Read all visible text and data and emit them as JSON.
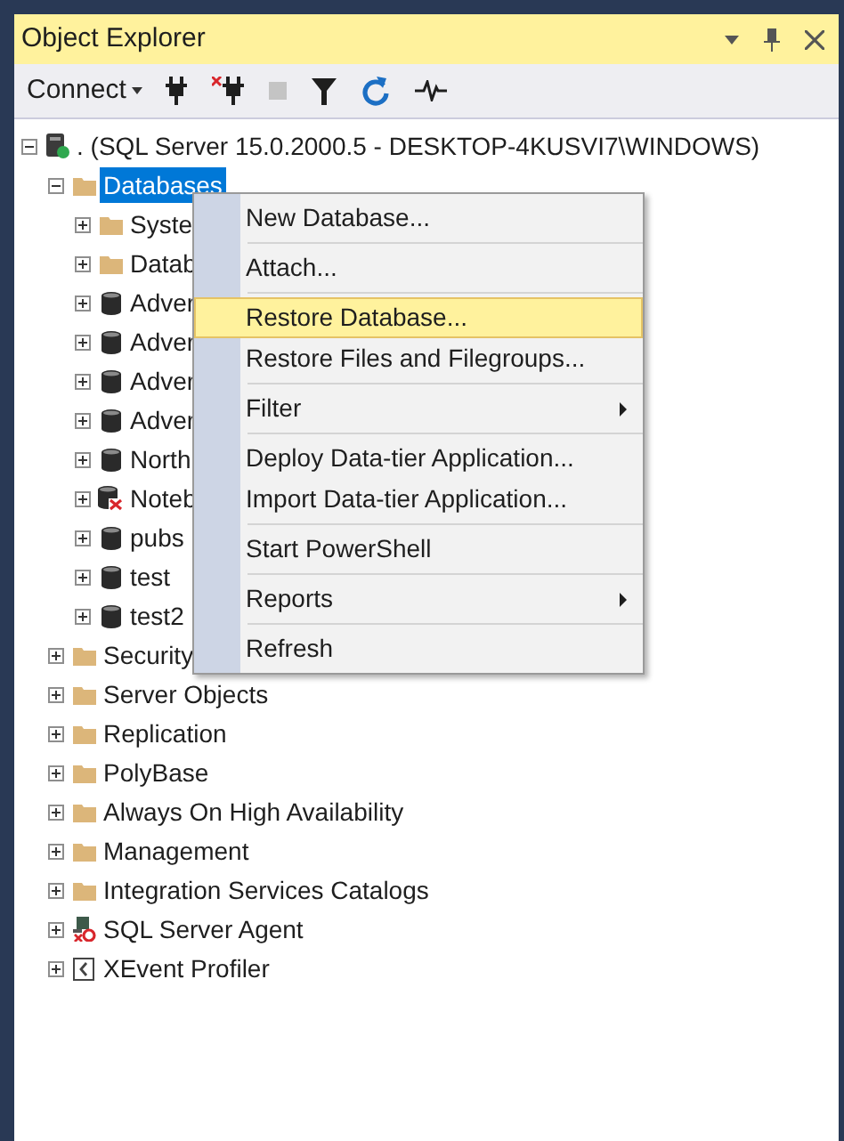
{
  "panel": {
    "title": "Object Explorer"
  },
  "toolbar": {
    "connect_label": "Connect",
    "buttons": [
      {
        "kind": "connect",
        "disabled": false
      },
      {
        "kind": "disconnect",
        "disabled": false
      },
      {
        "kind": "stop",
        "disabled": true
      },
      {
        "kind": "filter",
        "disabled": false
      },
      {
        "kind": "refresh",
        "disabled": false
      },
      {
        "kind": "activity",
        "disabled": false
      }
    ]
  },
  "tree": [
    {
      "label": ". (SQL Server 15.0.2000.5 - DESKTOP-4KUSVI7\\WINDOWS)",
      "kind": "server",
      "expanded": true,
      "selected": false,
      "children": [
        {
          "label": "Databases",
          "kind": "folder",
          "expanded": true,
          "selected": true,
          "children": [
            {
              "label": "Syste",
              "kind": "folder",
              "expanded": false,
              "selected": false
            },
            {
              "label": "Datab",
              "kind": "folder",
              "expanded": false,
              "selected": false
            },
            {
              "label": "Adver",
              "kind": "database",
              "expanded": false,
              "selected": false
            },
            {
              "label": "Adver",
              "kind": "database",
              "expanded": false,
              "selected": false
            },
            {
              "label": "Adver",
              "kind": "database",
              "expanded": false,
              "selected": false
            },
            {
              "label": "Adver",
              "kind": "database",
              "expanded": false,
              "selected": false
            },
            {
              "label": "North",
              "kind": "database",
              "expanded": false,
              "selected": false
            },
            {
              "label": "Noteb",
              "kind": "database-error",
              "expanded": false,
              "selected": false
            },
            {
              "label": "pubs",
              "kind": "database",
              "expanded": false,
              "selected": false
            },
            {
              "label": "test",
              "kind": "database",
              "expanded": false,
              "selected": false
            },
            {
              "label": "test2",
              "kind": "database",
              "expanded": false,
              "selected": false
            }
          ]
        },
        {
          "label": "Security",
          "kind": "folder",
          "expanded": false,
          "selected": false
        },
        {
          "label": "Server Objects",
          "kind": "folder",
          "expanded": false,
          "selected": false
        },
        {
          "label": "Replication",
          "kind": "folder",
          "expanded": false,
          "selected": false
        },
        {
          "label": "PolyBase",
          "kind": "folder",
          "expanded": false,
          "selected": false
        },
        {
          "label": "Always On High Availability",
          "kind": "folder",
          "expanded": false,
          "selected": false
        },
        {
          "label": "Management",
          "kind": "folder",
          "expanded": false,
          "selected": false
        },
        {
          "label": "Integration Services Catalogs",
          "kind": "folder",
          "expanded": false,
          "selected": false
        },
        {
          "label": "SQL Server Agent",
          "kind": "agent",
          "expanded": false,
          "selected": false
        },
        {
          "label": "XEvent Profiler",
          "kind": "xevent",
          "expanded": false,
          "selected": false
        }
      ]
    }
  ],
  "context_menu": {
    "groups": [
      [
        {
          "label": "New Database...",
          "highlighted": false,
          "submenu": false
        }
      ],
      [
        {
          "label": "Attach...",
          "highlighted": false,
          "submenu": false
        }
      ],
      [
        {
          "label": "Restore Database...",
          "highlighted": true,
          "submenu": false
        },
        {
          "label": "Restore Files and Filegroups...",
          "highlighted": false,
          "submenu": false
        }
      ],
      [
        {
          "label": "Filter",
          "highlighted": false,
          "submenu": true
        }
      ],
      [
        {
          "label": "Deploy Data-tier Application...",
          "highlighted": false,
          "submenu": false
        },
        {
          "label": "Import Data-tier Application...",
          "highlighted": false,
          "submenu": false
        }
      ],
      [
        {
          "label": "Start PowerShell",
          "highlighted": false,
          "submenu": false
        }
      ],
      [
        {
          "label": "Reports",
          "highlighted": false,
          "submenu": true
        }
      ],
      [
        {
          "label": "Refresh",
          "highlighted": false,
          "submenu": false
        }
      ]
    ]
  }
}
